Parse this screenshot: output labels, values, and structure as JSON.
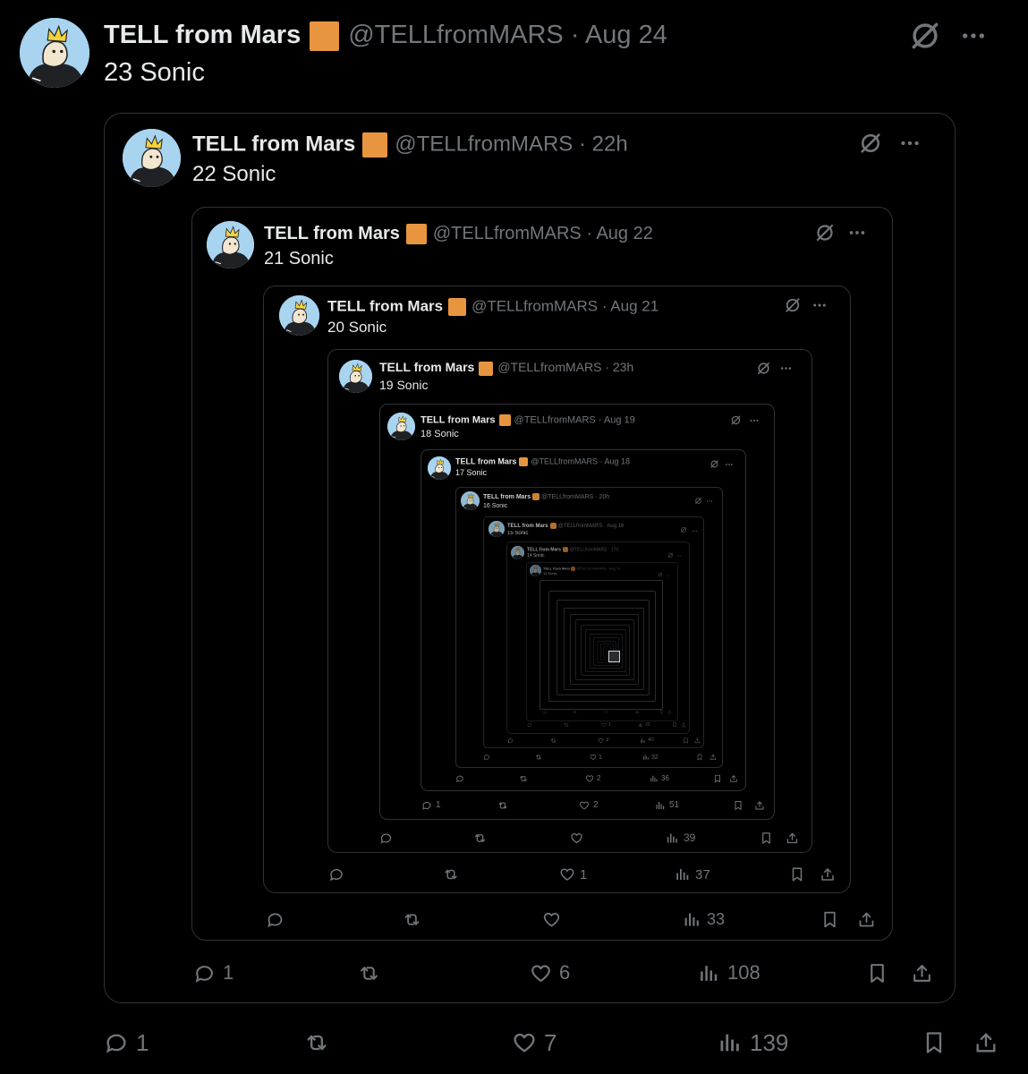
{
  "tweets": [
    {
      "name": "TELL from Mars",
      "handle": "@TELLfromMARS",
      "date": "Aug 24",
      "text": "23 Sonic",
      "replies": "1",
      "likes": "7",
      "views": "139",
      "retweets": ""
    },
    {
      "name": "TELL from Mars",
      "handle": "@TELLfromMARS",
      "date": "22h",
      "text": "22 Sonic",
      "replies": "1",
      "likes": "6",
      "views": "108",
      "retweets": ""
    },
    {
      "name": "TELL from Mars",
      "handle": "@TELLfromMARS",
      "date": "Aug 22",
      "text": "21 Sonic",
      "replies": "",
      "likes": "",
      "views": "33",
      "retweets": ""
    },
    {
      "name": "TELL from Mars",
      "handle": "@TELLfromMARS",
      "date": "Aug 21",
      "text": "20 Sonic",
      "replies": "",
      "likes": "1",
      "views": "37",
      "retweets": ""
    },
    {
      "name": "TELL from Mars",
      "handle": "@TELLfromMARS",
      "date": "23h",
      "text": "19 Sonic",
      "replies": "",
      "likes": "",
      "views": "39",
      "retweets": ""
    },
    {
      "name": "TELL from Mars",
      "handle": "@TELLfromMARS",
      "date": "Aug 19",
      "text": "18 Sonic",
      "replies": "1",
      "likes": "2",
      "views": "51",
      "retweets": ""
    },
    {
      "name": "TELL from Mars",
      "handle": "@TELLfromMARS",
      "date": "Aug 18",
      "text": "17 Sonic",
      "replies": "",
      "likes": "2",
      "views": "36",
      "retweets": ""
    },
    {
      "name": "TELL from Mars",
      "handle": "@TELLfromMARS",
      "date": "20h",
      "text": "16 Sonic",
      "replies": "",
      "likes": "1",
      "views": "32",
      "retweets": ""
    },
    {
      "name": "TELL from Mars",
      "handle": "@TELLfromMARS",
      "date": "Aug 16",
      "text": "15 Sonic",
      "replies": "",
      "likes": "3",
      "views": "40",
      "retweets": ""
    },
    {
      "name": "TELL from Mars",
      "handle": "@TELLfromMARS",
      "date": "17h",
      "text": "14 Sonic",
      "replies": "",
      "likes": "1",
      "views": "33",
      "retweets": ""
    },
    {
      "name": "TELL from Mars",
      "handle": "@TELLfromMARS",
      "date": "Aug 14",
      "text": "13 Sonic",
      "replies": "",
      "likes": "",
      "views": "",
      "retweets": ""
    }
  ],
  "icons": {
    "reply": "reply-icon",
    "retweet": "retweet-icon",
    "like": "heart-icon",
    "views": "views-icon",
    "bookmark": "bookmark-icon",
    "share": "share-icon",
    "grok": "grok-icon",
    "more": "more-icon",
    "badge": "verified-badge"
  },
  "colors": {
    "background": "#000000",
    "text": "#e7e9ea",
    "muted": "#71767b",
    "border": "#2f3336",
    "badge": "#e8953f",
    "avatar_bg": "#a8d4f0"
  }
}
